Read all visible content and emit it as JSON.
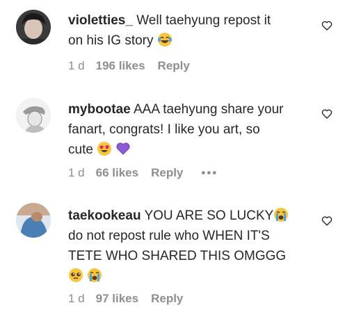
{
  "comments": [
    {
      "username": "violetties_",
      "text_lines": [
        "Well taehyung repost it",
        "on his IG story"
      ],
      "emojis": [
        "laughing-tears-emoji"
      ],
      "time": "1 d",
      "likes": "196 likes",
      "reply": "Reply"
    },
    {
      "username": "mybootae",
      "text_lines": [
        "AAA taehyung share your",
        "fanart, congrats! I like you art, so",
        "cute"
      ],
      "emojis": [
        "heart-eyes-emoji",
        "purple-heart-emoji"
      ],
      "time": "1 d",
      "likes": "66 likes",
      "reply": "Reply",
      "more": "•••"
    },
    {
      "username": "taekookeau",
      "text_lines": [
        "YOU ARE SO LUCKY",
        "do not repost rule who WHEN IT'S",
        "TETE WHO SHARED THIS OMGGG"
      ],
      "emojis": [
        "loudly-crying-emoji",
        "pleading-face-emoji",
        "loudly-crying-emoji"
      ],
      "time": "1 d",
      "likes": "97 likes",
      "reply": "Reply"
    }
  ],
  "icons": {
    "like": "heart-outline-icon"
  },
  "colors": {
    "text": "#262626",
    "meta": "#8e8e8e",
    "purple_heart": "#8a5cd6",
    "emoji_yellow": "#f7c640"
  }
}
